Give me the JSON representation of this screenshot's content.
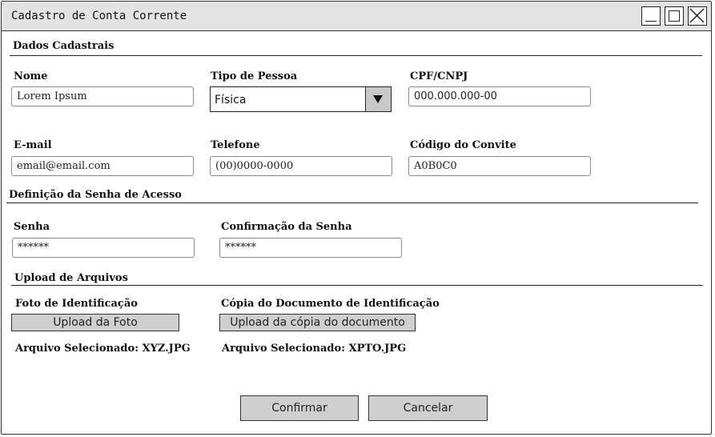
{
  "window": {
    "title": "Cadastro de Conta Corrente"
  },
  "sections": {
    "dados": "Dados Cadastrais",
    "senha": "Definição da Senha de Acesso",
    "upload": "Upload de Arquivos"
  },
  "fields": {
    "nome": {
      "label": "Nome",
      "value": "Lorem Ipsum"
    },
    "tipo": {
      "label": "Tipo de Pessoa",
      "value": "Física"
    },
    "cpf": {
      "label": "CPF/CNPJ",
      "value": "000.000.000-00"
    },
    "email": {
      "label": "E-mail",
      "value": "email@email.com"
    },
    "telefone": {
      "label": "Telefone",
      "value": "(00)0000-0000"
    },
    "convite": {
      "label": "Código do Convite",
      "value": "A0B0C0"
    },
    "senha": {
      "label": "Senha",
      "value": "******"
    },
    "confirmacao": {
      "label": "Confirmação da Senha",
      "value": "******"
    }
  },
  "uploads": {
    "foto": {
      "label": "Foto de Identificação",
      "button": "Upload da Foto",
      "selected": "Arquivo Selecionado: XYZ.JPG"
    },
    "documento": {
      "label": "Cópia do Documento de Identificação",
      "button": "Upload da cópia do documento",
      "selected": "Arquivo Selecionado: XPTO.JPG"
    }
  },
  "actions": {
    "confirm": "Confirmar",
    "cancel": "Cancelar"
  }
}
